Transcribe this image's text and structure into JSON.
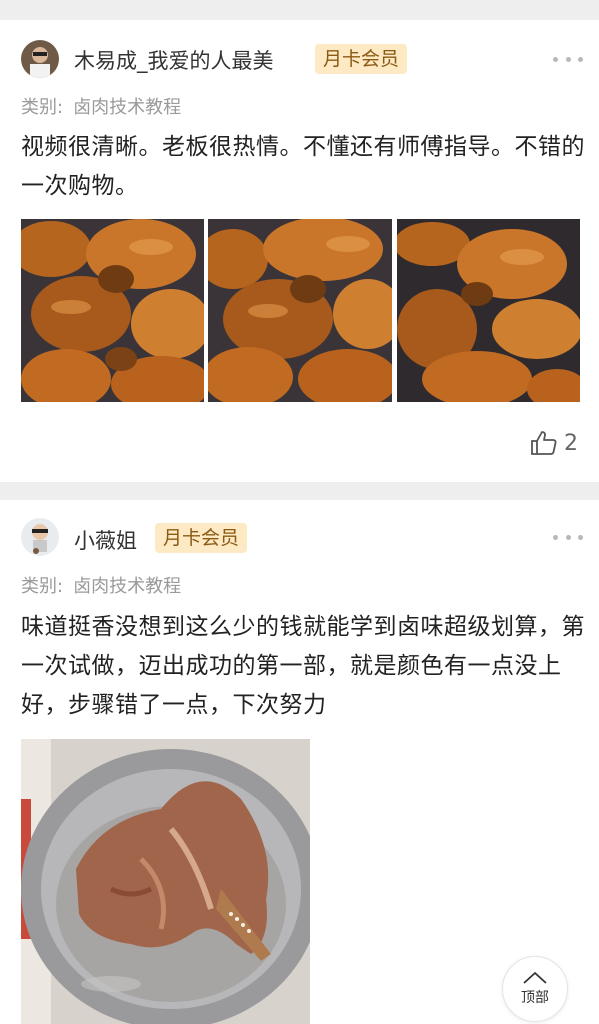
{
  "posts": [
    {
      "username": "木易成_我爱的人最美",
      "badge": "月卡会员",
      "category_label": "类别:",
      "category_value": "卤肉技术教程",
      "text": "视频很清晰。老板很热情。不懂还有师傅指导。不错的一次购物。",
      "image_count": 3,
      "likes": "2"
    },
    {
      "username": "小薇姐",
      "badge": "月卡会员",
      "category_label": "类别:",
      "category_value": "卤肉技术教程",
      "text": "味道挺香没想到这么少的钱就能学到卤味超级划算，第一次试做，迈出成功的第一部，就是颜色有一点没上好，步骤错了一点，下次努力",
      "image_count": 1
    }
  ],
  "back_to_top_label": "顶部",
  "colors": {
    "badge_bg": "#fde9c4",
    "badge_text": "#8a5a14",
    "separator": "#eeeeee"
  }
}
